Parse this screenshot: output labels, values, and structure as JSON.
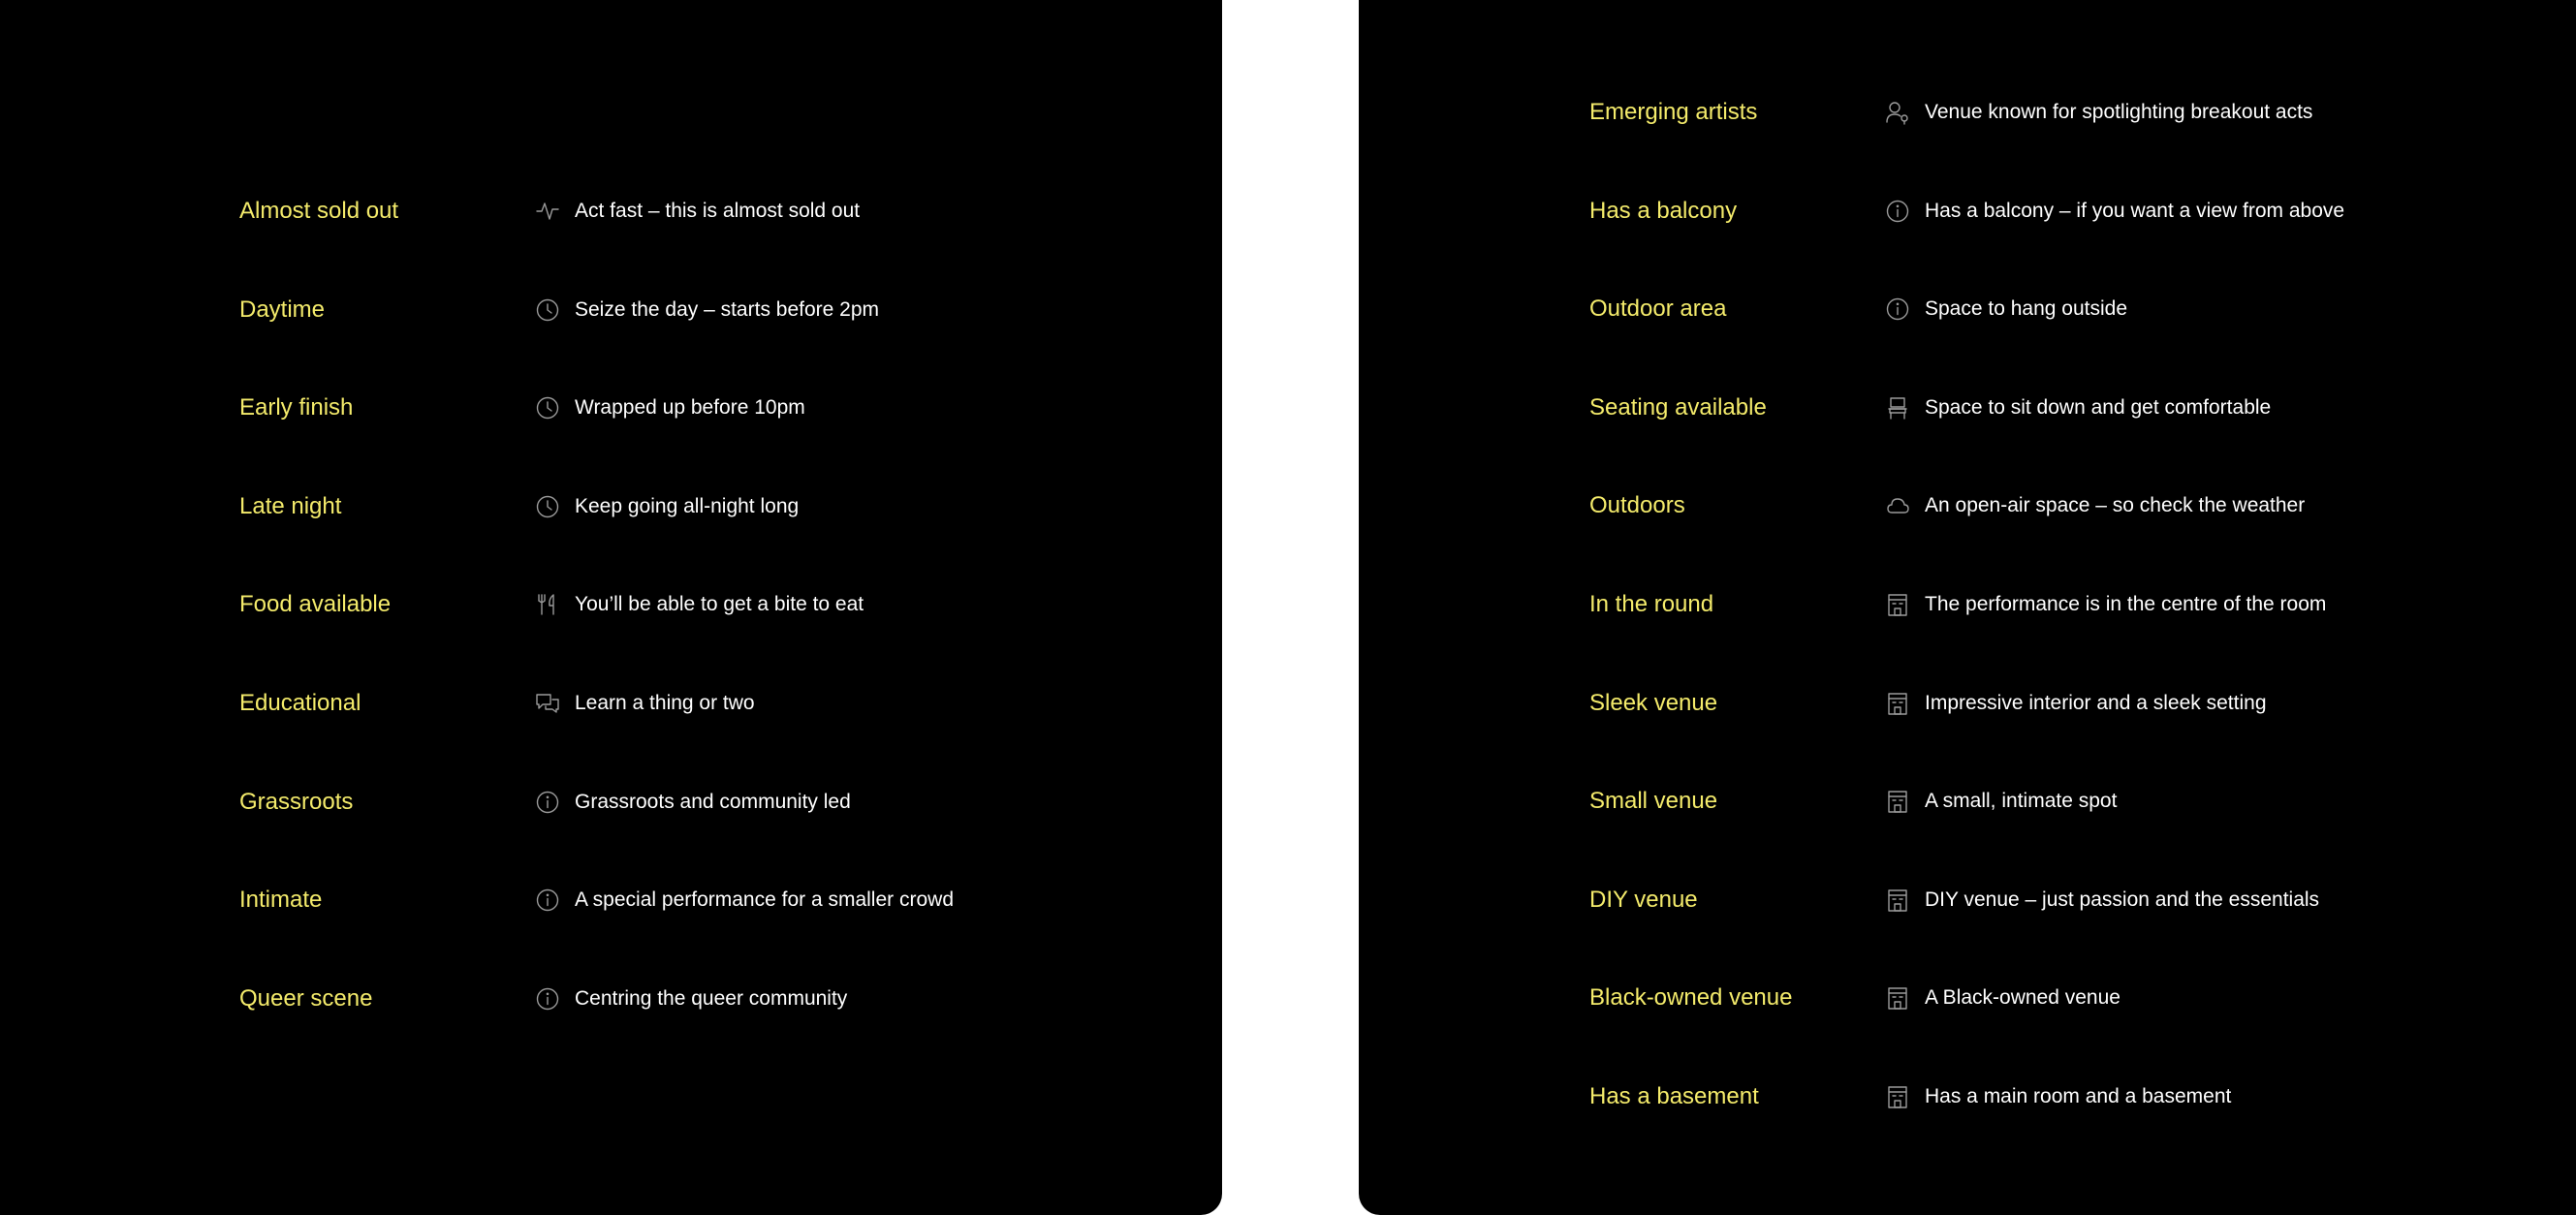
{
  "left_panel": {
    "items": [
      {
        "tag": "Almost sold out",
        "icon": "activity-icon",
        "description": "Act fast – this is almost sold out"
      },
      {
        "tag": "Daytime",
        "icon": "clock-icon",
        "description": "Seize the day – starts before 2pm"
      },
      {
        "tag": "Early finish",
        "icon": "clock-icon",
        "description": "Wrapped up before 10pm"
      },
      {
        "tag": "Late night",
        "icon": "clock-icon",
        "description": "Keep going all-night long"
      },
      {
        "tag": "Food available",
        "icon": "cutlery-icon",
        "description": "You’ll be able to get a bite to eat"
      },
      {
        "tag": "Educational",
        "icon": "chat-bubbles-icon",
        "description": "Learn a thing or two"
      },
      {
        "tag": "Grassroots",
        "icon": "info-icon",
        "description": "Grassroots and community led"
      },
      {
        "tag": "Intimate",
        "icon": "info-icon",
        "description": "A special performance for a smaller crowd"
      },
      {
        "tag": "Queer scene",
        "icon": "info-icon",
        "description": "Centring the queer community"
      }
    ]
  },
  "right_panel": {
    "items": [
      {
        "tag": "Emerging artists",
        "icon": "user-star-icon",
        "description": "Venue known for spotlighting breakout acts"
      },
      {
        "tag": "Has a balcony",
        "icon": "info-icon",
        "description": "Has a balcony – if you want a view from above"
      },
      {
        "tag": "Outdoor area",
        "icon": "info-icon",
        "description": "Space to hang outside"
      },
      {
        "tag": "Seating available",
        "icon": "seat-icon",
        "description": "Space to sit down and get comfortable"
      },
      {
        "tag": "Outdoors",
        "icon": "cloud-icon",
        "description": "An open-air space – so check the weather"
      },
      {
        "tag": "In the round",
        "icon": "building-icon",
        "description": "The performance is in the centre of the room"
      },
      {
        "tag": "Sleek venue",
        "icon": "building-icon",
        "description": "Impressive interior and a sleek setting"
      },
      {
        "tag": "Small venue",
        "icon": "building-icon",
        "description": "A small, intimate spot"
      },
      {
        "tag": "DIY venue",
        "icon": "building-icon",
        "description": "DIY venue – just passion and the essentials"
      },
      {
        "tag": "Black-owned venue",
        "icon": "building-icon",
        "description": "A Black-owned venue"
      },
      {
        "tag": "Has a basement",
        "icon": "building-icon",
        "description": "Has a main room and a basement"
      }
    ]
  },
  "colors": {
    "panel_background": "#000000",
    "page_background": "#ffffff",
    "tag_text": "#f4eb6b",
    "description_text": "#ffffff",
    "icon_stroke": "#9a9a9a"
  }
}
